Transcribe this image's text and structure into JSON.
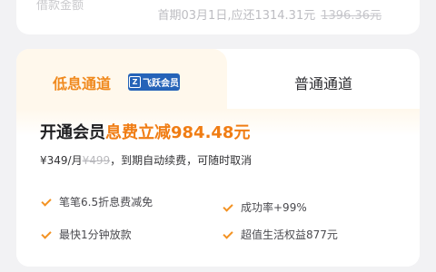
{
  "top": {
    "left_text": "借款金额",
    "first_payment": "首期03月1日,应还1314.31元",
    "original_amount": "1396.36元"
  },
  "tabs": {
    "low_interest_label": "低息通道",
    "vip_badge_text": "飞跃会员",
    "normal_label": "普通通道"
  },
  "offer": {
    "headline_prefix": "开通会员",
    "headline_highlight": "息费立减984.48元",
    "price": "¥349/月",
    "original_price": "¥499",
    "price_note": "，到期自动续费，可随时取消"
  },
  "benefits": [
    {
      "label": "笔笔6.5折息费减免"
    },
    {
      "label": "成功率+99%"
    },
    {
      "label": "最快1分钟放款"
    },
    {
      "label": "超值生活权益877元"
    }
  ],
  "colors": {
    "accent": "#f08a1f",
    "badge": "#2563b8",
    "background": "#f2f2f4"
  }
}
